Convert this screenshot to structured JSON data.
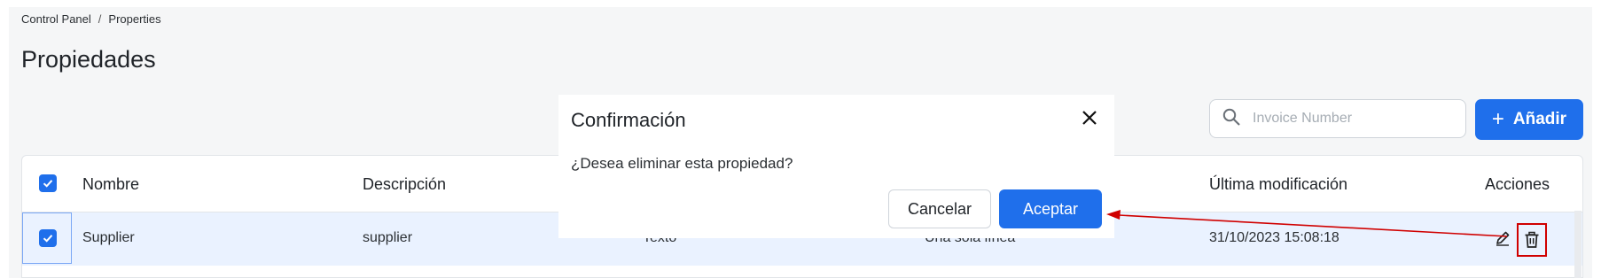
{
  "breadcrumb": {
    "root": "Control Panel",
    "separator": "/",
    "current": "Properties"
  },
  "page_title": "Propiedades",
  "search": {
    "placeholder": "Invoice Number",
    "value": ""
  },
  "add_button": {
    "icon": "plus-icon",
    "label": "Añadir"
  },
  "table": {
    "headers": {
      "name": "Nombre",
      "description": "Descripción",
      "last_modified": "Última modificación",
      "actions": "Acciones"
    },
    "rows": [
      {
        "name": "Supplier",
        "description": "supplier",
        "type": "Texto",
        "format": "Una sola línea",
        "last_modified": "31/10/2023 15:08:18",
        "selected": true
      }
    ]
  },
  "modal": {
    "title": "Confirmación",
    "message": "¿Desea eliminar esta propiedad?",
    "cancel_label": "Cancelar",
    "accept_label": "Aceptar",
    "close_icon": "close-icon"
  },
  "colors": {
    "accent": "#1f6feb",
    "annotation": "#d00000",
    "row_selected": "#eaf2ff",
    "panel_bg": "#f5f6f7"
  }
}
